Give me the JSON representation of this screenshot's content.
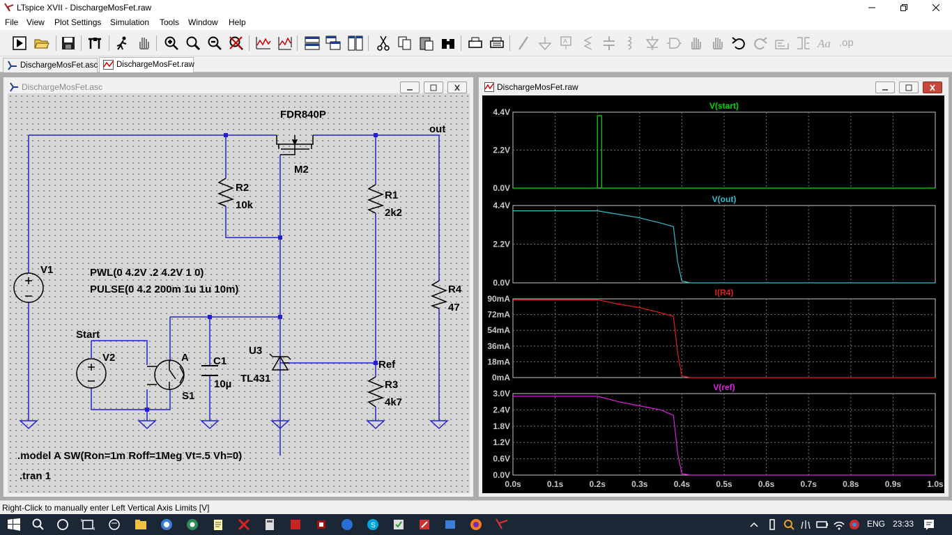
{
  "window": {
    "title": "LTspice XVII - DischargeMosFet.raw",
    "controls": [
      "minimize",
      "restore",
      "close"
    ]
  },
  "menu": [
    "File",
    "View",
    "Plot Settings",
    "Simulation",
    "Tools",
    "Window",
    "Help"
  ],
  "toolbar_icons": [
    "run-icon",
    "open-icon",
    "save-icon",
    "control-panel-icon",
    "probe-icon",
    "pan-icon",
    "zoom-in-icon",
    "zoom-area-icon",
    "zoom-out-icon",
    "zoom-cancel-icon",
    "autorange-icon",
    "autorange-y-icon",
    "tile-horizontal-icon",
    "cascade-icon",
    "tile-vertical-icon",
    "cut-icon",
    "copy-icon",
    "paste-icon",
    "find-icon",
    "print-preview-icon",
    "print-icon",
    "wire-icon",
    "ground-icon",
    "label-icon",
    "resistor-icon",
    "capacitor-icon",
    "inductor-icon",
    "diode-icon",
    "component-icon",
    "move-icon",
    "drag-icon",
    "undo-icon",
    "redo-icon",
    "rotate-icon",
    "mirror-icon",
    "text-icon",
    "spice-directive-icon"
  ],
  "tabs": [
    {
      "label": "DischargeMosFet.asc",
      "icon": "schematic-icon"
    },
    {
      "label": "DischargeMosFet.raw",
      "icon": "waveform-icon"
    }
  ],
  "schematic": {
    "title": "DischargeMosFet.asc",
    "labels": {
      "m2_model": "FDR840P",
      "m2_name": "M2",
      "out": "out",
      "r2_name": "R2",
      "r2_value": "10k",
      "r1_name": "R1",
      "r1_value": "2k2",
      "v1_name": "V1",
      "v1_pwl": "PWL(0 4.2V .2 4.2V 1 0)",
      "v1_pulse": "PULSE(0 4.2 200m 1u 1u 10m)",
      "r4_name": "R4",
      "r4_value": "47",
      "start": "Start",
      "v2_name": "V2",
      "switch_model": "A",
      "s1_name": "S1",
      "c1_name": "C1",
      "c1_value": "10µ",
      "u3_name": "U3",
      "u3_model": "TL431",
      "ref": "Ref",
      "r3_name": "R3",
      "r3_value": "4k7",
      "model_directive": ".model A SW(Ron=1m Roff=1Meg Vt=.5 Vh=0)",
      "tran_directive": ".tran 1"
    }
  },
  "waveform": {
    "title": "DischargeMosFet.raw",
    "colors": {
      "start": "#00dc00",
      "out": "#30c0d0",
      "r4": "#e02020",
      "ref": "#e020e0",
      "grid": "#7a7a7a",
      "axis": "#c8c8c8"
    }
  },
  "chart_data": [
    {
      "type": "line",
      "title": "V(start)",
      "ylabel": "",
      "xlabel": "",
      "ylim": [
        0,
        4.4
      ],
      "yticks": [
        "4.4V",
        "2.2V",
        "0.0V"
      ],
      "xlim": [
        0,
        1
      ],
      "series": [
        {
          "name": "V(start)",
          "x": [
            0,
            0.2,
            0.20001,
            0.21,
            0.21001,
            1.0
          ],
          "values": [
            0,
            0,
            4.2,
            4.2,
            0,
            0
          ]
        }
      ]
    },
    {
      "type": "line",
      "title": "V(out)",
      "ylabel": "",
      "xlabel": "",
      "ylim": [
        0,
        4.4
      ],
      "yticks": [
        "4.4V",
        "2.2V",
        "0.0V"
      ],
      "xlim": [
        0,
        1
      ],
      "series": [
        {
          "name": "V(out)",
          "x": [
            0,
            0.2,
            0.25,
            0.3,
            0.35,
            0.38,
            0.39,
            0.4,
            0.42,
            1.0
          ],
          "values": [
            4.1,
            4.1,
            3.9,
            3.7,
            3.4,
            3.2,
            1.2,
            0.1,
            0.0,
            0.0
          ]
        }
      ]
    },
    {
      "type": "line",
      "title": "I(R4)",
      "ylabel": "",
      "xlabel": "",
      "ylim": [
        0,
        90
      ],
      "yticks": [
        "90mA",
        "72mA",
        "54mA",
        "36mA",
        "18mA",
        "0mA"
      ],
      "xlim": [
        0,
        1
      ],
      "series": [
        {
          "name": "I(R4)",
          "x": [
            0,
            0.2,
            0.25,
            0.3,
            0.35,
            0.38,
            0.39,
            0.4,
            0.42,
            1.0
          ],
          "values": [
            89,
            89,
            84,
            80,
            74,
            70,
            28,
            2,
            0,
            0
          ]
        }
      ]
    },
    {
      "type": "line",
      "title": "V(ref)",
      "ylabel": "",
      "xlabel": "",
      "ylim": [
        0,
        3.0
      ],
      "yticks": [
        "3.0V",
        "2.4V",
        "1.8V",
        "1.2V",
        "0.6V",
        "0.0V"
      ],
      "xlim": [
        0,
        1
      ],
      "xticks": [
        "0.0s",
        "0.1s",
        "0.2s",
        "0.3s",
        "0.4s",
        "0.5s",
        "0.6s",
        "0.7s",
        "0.8s",
        "0.9s",
        "1.0s"
      ],
      "series": [
        {
          "name": "V(ref)",
          "x": [
            0,
            0.2,
            0.25,
            0.3,
            0.35,
            0.38,
            0.39,
            0.4,
            0.42,
            1.0
          ],
          "values": [
            2.9,
            2.9,
            2.7,
            2.55,
            2.4,
            2.2,
            0.8,
            0.05,
            0.0,
            0.0
          ]
        }
      ]
    }
  ],
  "statusbar": {
    "text": "Right-Click to manually enter Left Vertical Axis Limits [V]"
  },
  "taskbar": {
    "language": "ENG",
    "time": "23:33"
  }
}
